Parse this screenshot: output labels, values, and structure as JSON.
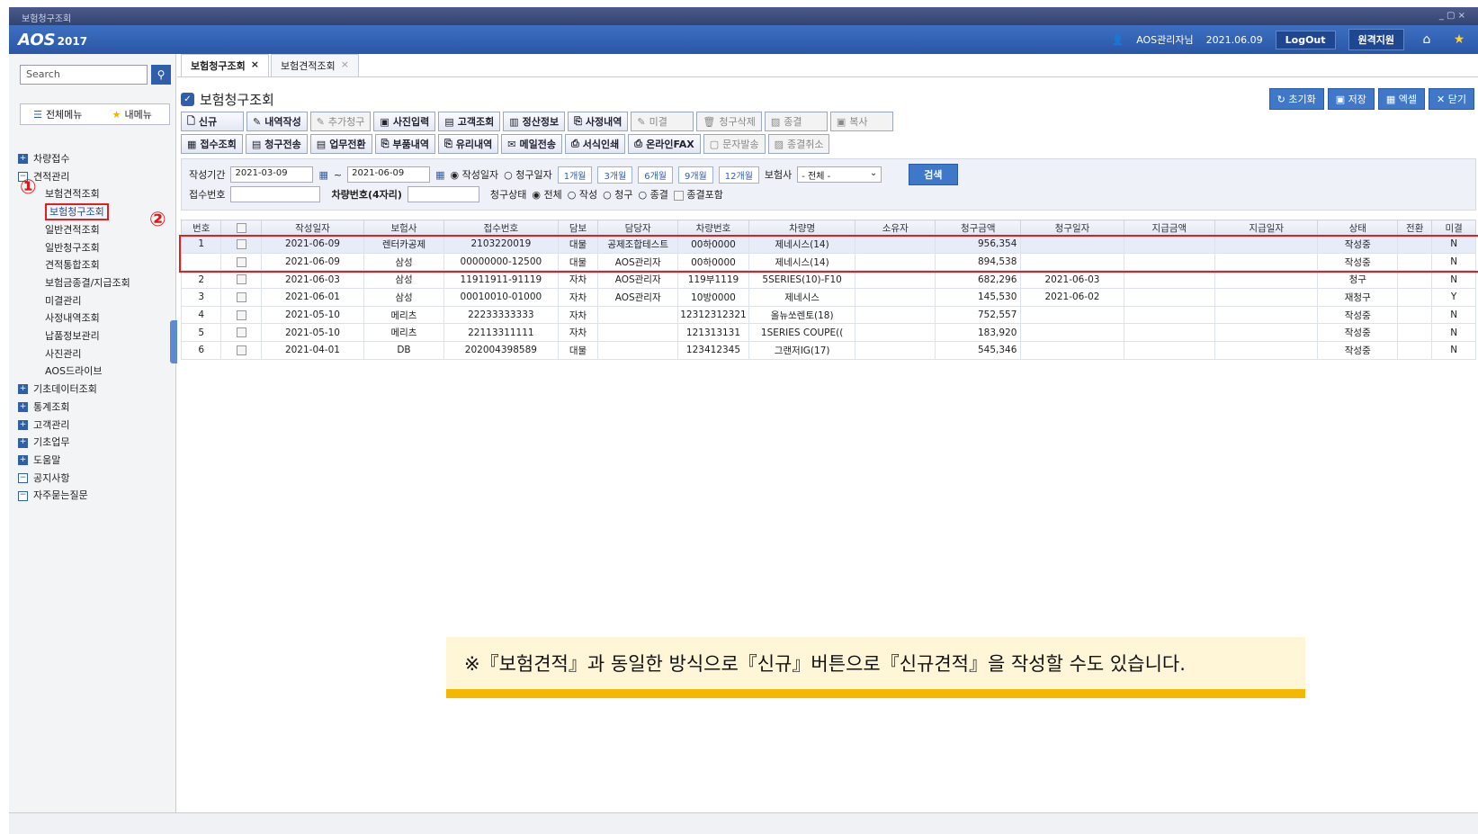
{
  "window": {
    "title": "보험청구조회",
    "controls": "_ ▢ ×"
  },
  "app": {
    "logo": "AOS",
    "logo_year": "2017",
    "user": "AOS관리자님",
    "date": "2021.06.09",
    "logout": "LogOut",
    "remote": "원격지원"
  },
  "sidebar": {
    "search_placeholder": "Search",
    "tab_all": "전체메뉴",
    "tab_my": "내메뉴",
    "tree": {
      "g1": "차량접수",
      "g2": "견적관리",
      "i1": "보험견적조회",
      "i2": "보험청구조회",
      "i3": "일반견적조회",
      "i4": "일반청구조회",
      "i5": "견적통합조회",
      "i6": "보험금종결/지급조회",
      "i7": "미결관리",
      "i8": "사정내역조회",
      "i9": "납품정보관리",
      "i10": "사진관리",
      "i11": "AOS드라이브",
      "g3": "기초데이터조회",
      "g4": "통계조회",
      "g5": "고객관리",
      "g6": "기초업무",
      "g7": "도움말",
      "g8": "공지사항",
      "g9": "자주묻는질문"
    }
  },
  "markers": {
    "m1": "①",
    "m2": "②"
  },
  "tabs": {
    "t1": "보험청구조회",
    "t2": "보험견적조회"
  },
  "page": {
    "title": "보험청구조회"
  },
  "actions": {
    "reset": "초기화",
    "save": "저장",
    "excel": "엑셀",
    "close": "닫기"
  },
  "toolbar1": {
    "new": "신규",
    "detail": "내역작성",
    "add": "추가청구",
    "photo": "사진입력",
    "customer": "고객조회",
    "settle": "정산정보",
    "assess": "사정내역",
    "pending": "미결",
    "delete": "청구삭제",
    "close": "종결",
    "copy": "복사"
  },
  "toolbar2": {
    "receipt": "접수조회",
    "send": "청구전송",
    "transfer": "업무전환",
    "parts": "부품내역",
    "glass": "유리내역",
    "mail": "메일전송",
    "print": "서식인쇄",
    "fax": "온라인FAX",
    "sms": "문자발송",
    "cancel": "종결취소"
  },
  "filter": {
    "period_label": "작성기간",
    "from": "2021-03-09",
    "to": "2021-06-09",
    "tilde": "~",
    "opt_write": "작성일자",
    "opt_claim": "청구일자",
    "p1": "1개월",
    "p3": "3개월",
    "p6": "6개월",
    "p9": "9개월",
    "p12": "12개월",
    "insurer_label": "보험사",
    "insurer_value": "- 전체 -",
    "search": "검색",
    "receipt_label": "접수번호",
    "car_label": "차량번호(4자리)",
    "status_label": "청구상태",
    "s_all": "전체",
    "s_write": "작성",
    "s_claim": "청구",
    "s_close": "종결",
    "include_closed": "종결포함"
  },
  "grid": {
    "headers": [
      "번호",
      "",
      "작성일자",
      "보험사",
      "접수번호",
      "담보",
      "담당자",
      "차량번호",
      "차량명",
      "소유자",
      "청구금액",
      "청구일자",
      "지급금액",
      "지급일자",
      "상태",
      "전환",
      "미결"
    ],
    "rows": [
      [
        "1",
        "",
        "2021-06-09",
        "렌터카공제",
        "2103220019",
        "대물",
        "공제조합테스트",
        "00하0000",
        "제네시스(14)",
        "",
        "956,354",
        "",
        "",
        "",
        "작성중",
        "",
        "N"
      ],
      [
        "",
        "",
        "2021-06-09",
        "삼성",
        "00000000-12500",
        "대물",
        "AOS관리자",
        "00하0000",
        "제네시스(14)",
        "",
        "894,538",
        "",
        "",
        "",
        "작성중",
        "",
        "N"
      ],
      [
        "2",
        "",
        "2021-06-03",
        "삼성",
        "11911911-91119",
        "자차",
        "AOS관리자",
        "119부1119",
        "5SERIES(10)-F10",
        "",
        "682,296",
        "2021-06-03",
        "",
        "",
        "청구",
        "",
        "N"
      ],
      [
        "3",
        "",
        "2021-06-01",
        "삼성",
        "00010010-01000",
        "자차",
        "AOS관리자",
        "10방0000",
        "제네시스",
        "",
        "145,530",
        "2021-06-02",
        "",
        "",
        "재청구",
        "",
        "Y"
      ],
      [
        "4",
        "",
        "2021-05-10",
        "메리츠",
        "22233333333",
        "자차",
        "",
        "12312312321",
        "올뉴쏘렌토(18)",
        "",
        "752,557",
        "",
        "",
        "",
        "작성중",
        "",
        "N"
      ],
      [
        "5",
        "",
        "2021-05-10",
        "메리츠",
        "22113311111",
        "자차",
        "",
        "121313131",
        "1SERIES COUPE((",
        "",
        "183,920",
        "",
        "",
        "",
        "작성중",
        "",
        "N"
      ],
      [
        "6",
        "",
        "2021-04-01",
        "DB",
        "202004398589",
        "대물",
        "",
        "123412345",
        "그랜저IG(17)",
        "",
        "545,346",
        "",
        "",
        "",
        "작성중",
        "",
        "N"
      ]
    ]
  },
  "note": "※『보험견적』과 동일한 방식으로『신규』버튼으로『신규견적』을 작성할 수도 있습니다."
}
